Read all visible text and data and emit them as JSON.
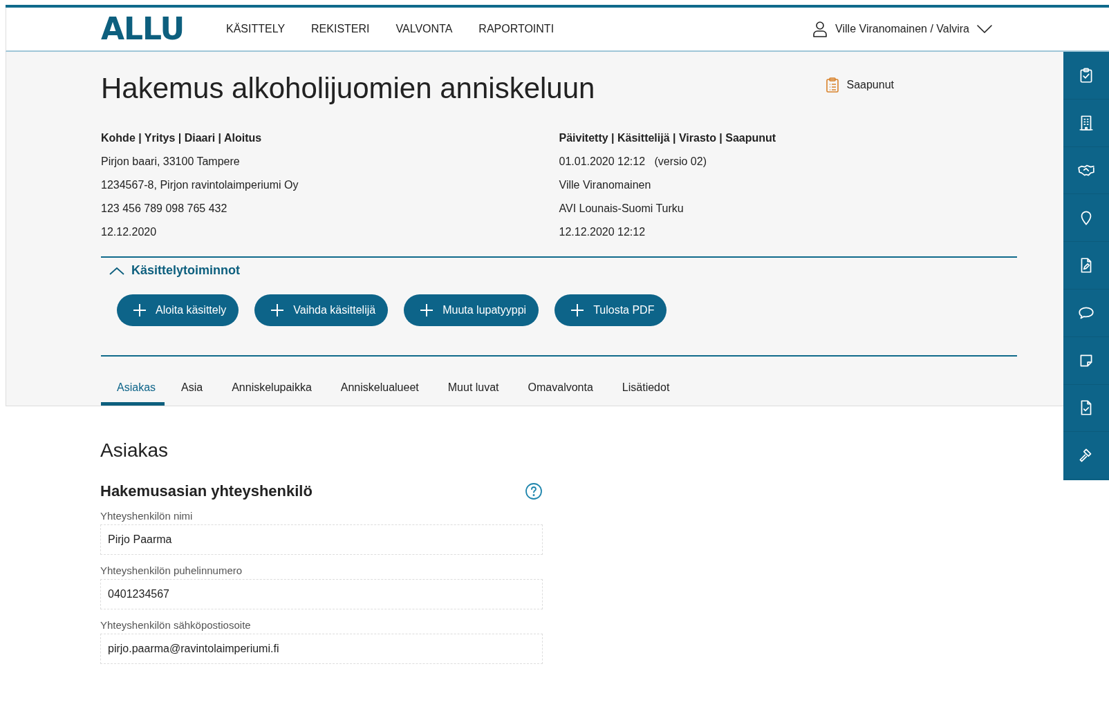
{
  "logo": "ALLU",
  "nav": [
    "KÄSITTELY",
    "REKISTERI",
    "VALVONTA",
    "RAPORTOINTI"
  ],
  "user": {
    "name": "Ville Viranomainen / Valvira"
  },
  "title": "Hakemus alkoholijuomien anniskeluun",
  "status": "Saapunut",
  "meta": [
    {
      "heading": "Kohde | Yritys | Diaari | Aloitus",
      "lines": [
        "Pirjon baari, 33100 Tampere",
        "1234567-8, Pirjon ravintolaimperiumi Oy",
        "123 456 789 098 765 432",
        "12.12.2020"
      ]
    },
    {
      "heading": "Päivitetty | Käsittelijä | Virasto | Saapunut",
      "lines": [
        "01.01.2020 12:12   (versio 02)",
        "Ville Viranomainen",
        "AVI Lounais-Suomi Turku",
        "12.12.2020 12:12"
      ]
    }
  ],
  "actions": {
    "title": "Käsittelytoiminnot",
    "expanded": true,
    "buttons": [
      "Aloita käsittely",
      "Vaihda käsittelijä",
      "Muuta lupatyyppi",
      "Tulosta PDF"
    ]
  },
  "tabs": [
    {
      "label": "Asiakas",
      "selected": true
    },
    {
      "label": "Asia",
      "selected": false
    },
    {
      "label": "Anniskelupaikka",
      "selected": false
    },
    {
      "label": "Anniskelualueet",
      "selected": false
    },
    {
      "label": "Muut luvat",
      "selected": false
    },
    {
      "label": "Omavalvonta",
      "selected": false
    },
    {
      "label": "Lisätiedot",
      "selected": false
    }
  ],
  "section": {
    "title": "Asiakas",
    "subtitle": "Hakemusasian yhteyshenkilö",
    "fields": [
      {
        "label": "Yhteyshenkilön nimi",
        "value": "Pirjo Paarma"
      },
      {
        "label": "Yhteyshenkilön puhelinnumero",
        "value": "0401234567"
      },
      {
        "label": "Yhteyshenkilön sähköpostiosoite",
        "value": "pirjo.paarma@ravintolaimperiumi.fi"
      }
    ]
  }
}
